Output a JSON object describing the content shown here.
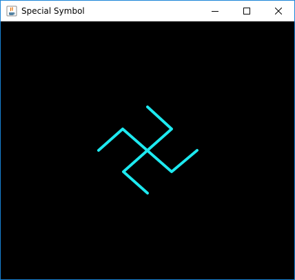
{
  "window": {
    "title": "Special Symbol",
    "border_color": "#1883d7"
  },
  "titlebar": {
    "app_icon": "java-icon",
    "controls": [
      "minimize-icon",
      "maximize-icon",
      "close-icon"
    ]
  },
  "canvas": {
    "background": "#000000",
    "stroke_color": "#1de9f0",
    "symbol": "cyan-swastika-lines"
  }
}
